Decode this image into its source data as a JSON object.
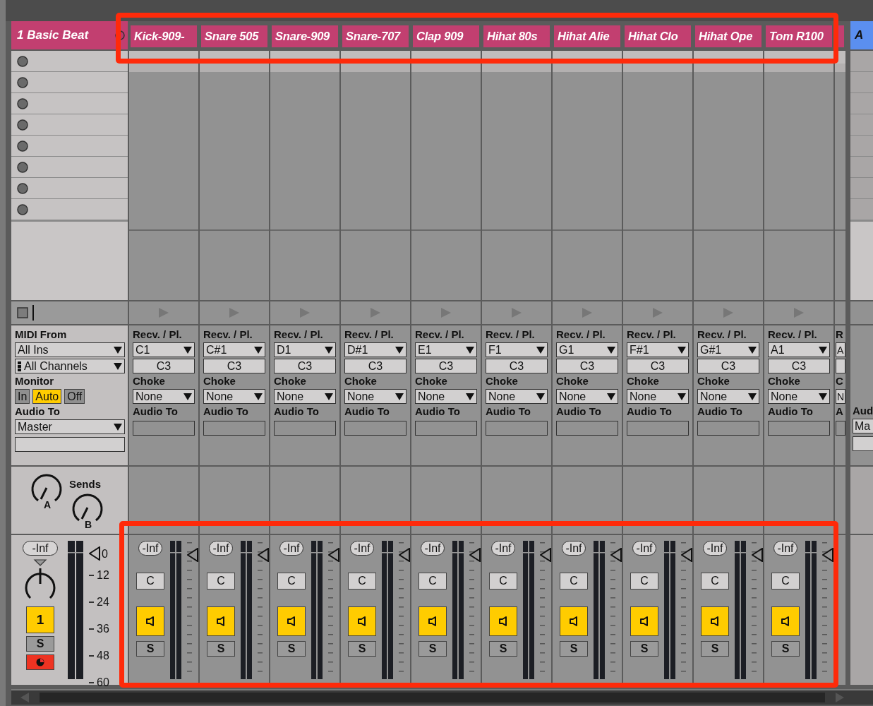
{
  "rack": {
    "title": "1 Basic Beat",
    "io": {
      "midi_from_label": "MIDI From",
      "midi_from": "All Ins",
      "channel": "All Channels",
      "monitor_label": "Monitor",
      "monitor": [
        {
          "label": "In",
          "selected": false
        },
        {
          "label": "Auto",
          "selected": true
        },
        {
          "label": "Off",
          "selected": false
        }
      ],
      "audio_to_label": "Audio To",
      "audio_to": "Master"
    },
    "sends": {
      "label": "Sends",
      "knobs": [
        {
          "label": "A"
        },
        {
          "label": "B"
        }
      ]
    },
    "mixer": {
      "volume": "-Inf",
      "activator": "1",
      "activator_on": true,
      "solo": "S",
      "armed": true,
      "scale": [
        "0",
        "12",
        "24",
        "36",
        "48",
        "60"
      ]
    }
  },
  "chains": [
    {
      "name": "Kick-909-",
      "receive_label": "Recv. / Pl.",
      "receive": "C1",
      "play": "C3",
      "choke_label": "Choke",
      "choke": "None",
      "audio_to_label": "Audio To",
      "volume": "-Inf",
      "chain_select": "C",
      "on": true,
      "solo": "S"
    },
    {
      "name": "Snare 505",
      "receive_label": "Recv. / Pl.",
      "receive": "C#1",
      "play": "C3",
      "choke_label": "Choke",
      "choke": "None",
      "audio_to_label": "Audio To",
      "volume": "-Inf",
      "chain_select": "C",
      "on": true,
      "solo": "S"
    },
    {
      "name": "Snare-909",
      "receive_label": "Recv. / Pl.",
      "receive": "D1",
      "play": "C3",
      "choke_label": "Choke",
      "choke": "None",
      "audio_to_label": "Audio To",
      "volume": "-Inf",
      "chain_select": "C",
      "on": true,
      "solo": "S"
    },
    {
      "name": "Snare-707",
      "receive_label": "Recv. / Pl.",
      "receive": "D#1",
      "play": "C3",
      "choke_label": "Choke",
      "choke": "None",
      "audio_to_label": "Audio To",
      "volume": "-Inf",
      "chain_select": "C",
      "on": true,
      "solo": "S"
    },
    {
      "name": "Clap 909",
      "receive_label": "Recv. / Pl.",
      "receive": "E1",
      "play": "C3",
      "choke_label": "Choke",
      "choke": "None",
      "audio_to_label": "Audio To",
      "volume": "-Inf",
      "chain_select": "C",
      "on": true,
      "solo": "S"
    },
    {
      "name": "Hihat 80s",
      "receive_label": "Recv. / Pl.",
      "receive": "F1",
      "play": "C3",
      "choke_label": "Choke",
      "choke": "None",
      "audio_to_label": "Audio To",
      "volume": "-Inf",
      "chain_select": "C",
      "on": true,
      "solo": "S"
    },
    {
      "name": "Hihat Alie",
      "receive_label": "Recv. / Pl.",
      "receive": "G1",
      "play": "C3",
      "choke_label": "Choke",
      "choke": "None",
      "audio_to_label": "Audio To",
      "volume": "-Inf",
      "chain_select": "C",
      "on": true,
      "solo": "S"
    },
    {
      "name": "Hihat Clo",
      "receive_label": "Recv. / Pl.",
      "receive": "F#1",
      "play": "C3",
      "choke_label": "Choke",
      "choke": "None",
      "audio_to_label": "Audio To",
      "volume": "-Inf",
      "chain_select": "C",
      "on": true,
      "solo": "S"
    },
    {
      "name": "Hihat Ope",
      "receive_label": "Recv. / Pl.",
      "receive": "G#1",
      "play": "C3",
      "choke_label": "Choke",
      "choke": "None",
      "audio_to_label": "Audio To",
      "volume": "-Inf",
      "chain_select": "C",
      "on": true,
      "solo": "S"
    },
    {
      "name": "Tom R100",
      "receive_label": "Recv. / Pl.",
      "receive": "A1",
      "play": "C3",
      "choke_label": "Choke",
      "choke": "None",
      "audio_to_label": "Audio To",
      "volume": "-Inf",
      "chain_select": "C",
      "on": true,
      "solo": "S"
    }
  ],
  "partial_chain": {
    "receive_label": "R",
    "receive": "A",
    "choke_label": "C",
    "choke": "N",
    "audio_to_label": "A"
  },
  "return_track": {
    "name": "A",
    "audio_to_label": "Aud",
    "audio_to": "Ma"
  }
}
